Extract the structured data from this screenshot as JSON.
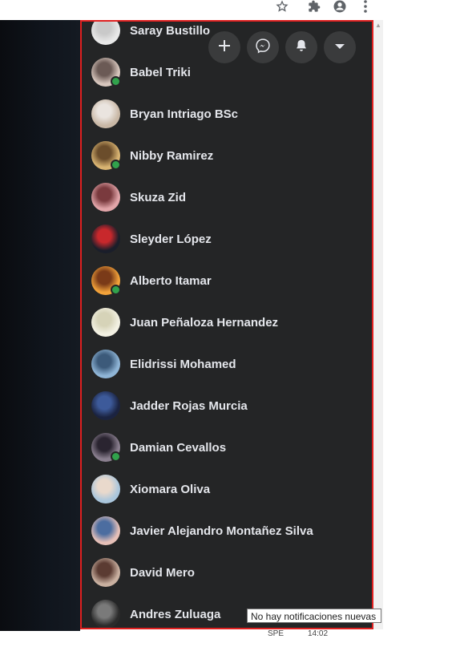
{
  "browser_toolbar": {
    "icons": [
      "star-icon",
      "extension-icon",
      "profile-icon",
      "menu-dots-icon"
    ]
  },
  "chat_header_buttons": [
    {
      "icon": "plus-icon"
    },
    {
      "icon": "messenger-icon"
    },
    {
      "icon": "bell-icon"
    },
    {
      "icon": "chevron-down-icon"
    }
  ],
  "contacts": [
    {
      "name": "Saray Bustillo",
      "online": false,
      "colors": [
        "#e8e8e8",
        "#c9c9c9"
      ]
    },
    {
      "name": "Babel Triki",
      "online": true,
      "colors": [
        "#d7c6bd",
        "#6b5a55"
      ]
    },
    {
      "name": "Bryan Intriago BSc",
      "online": false,
      "colors": [
        "#c9b8a6",
        "#eae4df"
      ]
    },
    {
      "name": "Nibby Ramirez",
      "online": true,
      "colors": [
        "#d9b472",
        "#6b4d2b"
      ]
    },
    {
      "name": "Skuza Zid",
      "online": false,
      "colors": [
        "#e2a5a9",
        "#7a3a3e"
      ]
    },
    {
      "name": "Sleyder López",
      "online": false,
      "colors": [
        "#1a1e2a",
        "#c8282c"
      ]
    },
    {
      "name": "Alberto Itamar",
      "online": true,
      "colors": [
        "#f2a23a",
        "#7a3a18"
      ]
    },
    {
      "name": "Juan Peñaloza Hernandez",
      "online": false,
      "colors": [
        "#f3f1e3",
        "#d6d3b8"
      ]
    },
    {
      "name": "Elidrissi Mohamed",
      "online": false,
      "colors": [
        "#8fb5d6",
        "#3c5a7a"
      ]
    },
    {
      "name": "Jadder Rojas Murcia",
      "online": false,
      "colors": [
        "#1b2340",
        "#3d5a9a"
      ]
    },
    {
      "name": "Damian Cevallos",
      "online": true,
      "colors": [
        "#8a7f8f",
        "#2a2430"
      ]
    },
    {
      "name": "Xiomara Oliva",
      "online": false,
      "colors": [
        "#aac6dc",
        "#e9d9cc"
      ]
    },
    {
      "name": "Javier Alejandro Montañez Silva",
      "online": false,
      "colors": [
        "#e6c0b8",
        "#4c6da0"
      ]
    },
    {
      "name": "David Mero",
      "online": false,
      "colors": [
        "#c9b0a0",
        "#5b3b32"
      ]
    },
    {
      "name": "Andres Zuluaga",
      "online": false,
      "colors": [
        "#2b2b2b",
        "#7a7a7a"
      ]
    }
  ],
  "tooltip": {
    "text": "No hay notificaciones nuevas"
  },
  "taskbar": {
    "fragment_left": "SPE",
    "fragment_right": "14:02"
  },
  "colors": {
    "panel_bg": "#242526",
    "name_text": "#e4e6eb",
    "online": "#31a24c",
    "highlight_border": "#e02020"
  }
}
